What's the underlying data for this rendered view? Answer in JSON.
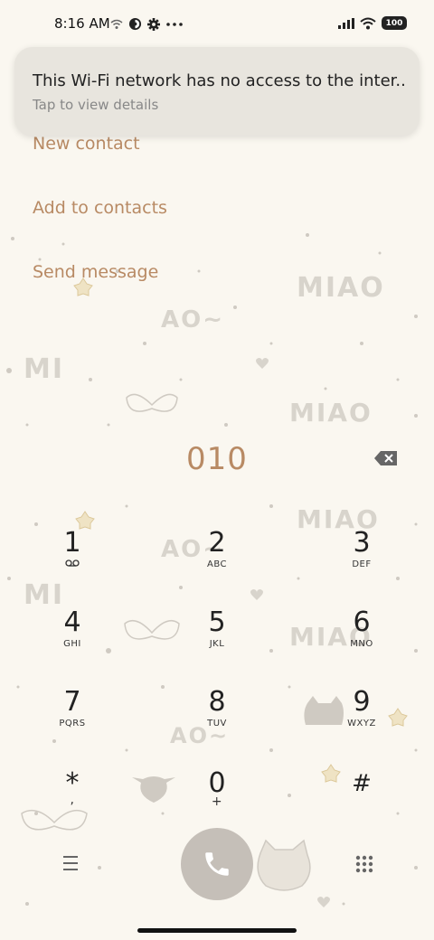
{
  "status_bar": {
    "time": "8:16 AM",
    "left_icons": [
      "wifi-question-icon",
      "data-saver-icon",
      "settings-icon",
      "more-dots-icon"
    ],
    "right_icons": [
      "signal-icon",
      "wifi-icon",
      "battery-icon"
    ],
    "battery_level": "100"
  },
  "notification": {
    "title": "This Wi-Fi network has no access to the inter..",
    "subtitle": "Tap to view details"
  },
  "options": {
    "new_contact": "New contact",
    "add_to_contacts": "Add to contacts",
    "send_message": "Send message"
  },
  "dialer": {
    "number": "010",
    "keys": [
      {
        "digit": "1",
        "letters": ""
      },
      {
        "digit": "2",
        "letters": "ABC"
      },
      {
        "digit": "3",
        "letters": "DEF"
      },
      {
        "digit": "4",
        "letters": "GHI"
      },
      {
        "digit": "5",
        "letters": "JKL"
      },
      {
        "digit": "6",
        "letters": "MNO"
      },
      {
        "digit": "7",
        "letters": "PQRS"
      },
      {
        "digit": "8",
        "letters": "TUV"
      },
      {
        "digit": "9",
        "letters": "WXYZ"
      },
      {
        "digit": "*",
        "letters": ","
      },
      {
        "digit": "0",
        "letters": "+"
      },
      {
        "digit": "#",
        "letters": ""
      }
    ]
  },
  "background": {
    "words": [
      "MIAO",
      "AO~",
      "MI",
      "MIAO",
      "MIAO",
      "AO~",
      "MI",
      "MIAO",
      "AO~"
    ]
  },
  "colors": {
    "accent": "#b88a64",
    "background": "#faf7f0",
    "call_button": "#c5bfb8"
  }
}
